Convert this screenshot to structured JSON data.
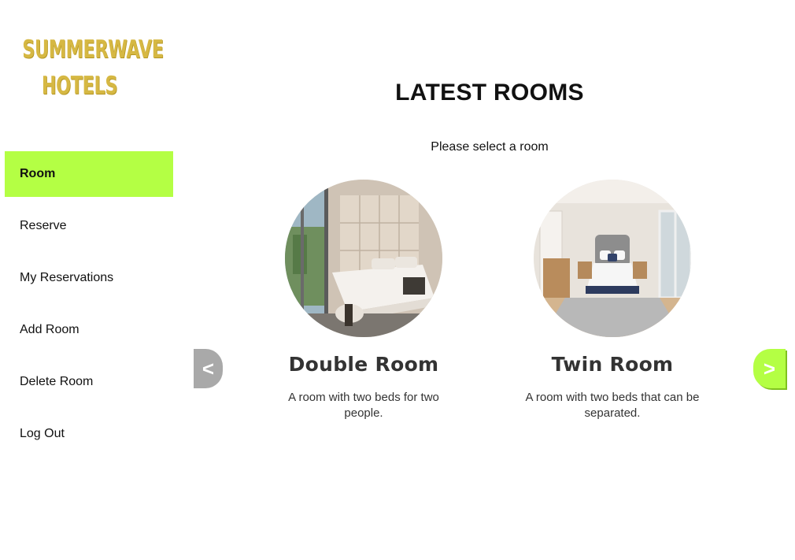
{
  "brand": {
    "line1": "SUMMERWAVE",
    "line2": "HOTELS",
    "color": "#d6b843"
  },
  "nav": {
    "items": [
      {
        "label": "Room",
        "active": true
      },
      {
        "label": "Reserve",
        "active": false
      },
      {
        "label": "My Reservations",
        "active": false
      },
      {
        "label": "Add Room",
        "active": false
      },
      {
        "label": "Delete Room",
        "active": false
      },
      {
        "label": "Log Out",
        "active": false
      }
    ],
    "active_color": "#b4ff44"
  },
  "main": {
    "title": "LATEST ROOMS",
    "subtitle": "Please select a room"
  },
  "carousel": {
    "prev_label": "<",
    "next_label": ">",
    "rooms": [
      {
        "name": "Double Room",
        "description": "A room with two beds for two people."
      },
      {
        "name": "Twin Room",
        "description": "A room with two beds that can be separated."
      }
    ]
  }
}
